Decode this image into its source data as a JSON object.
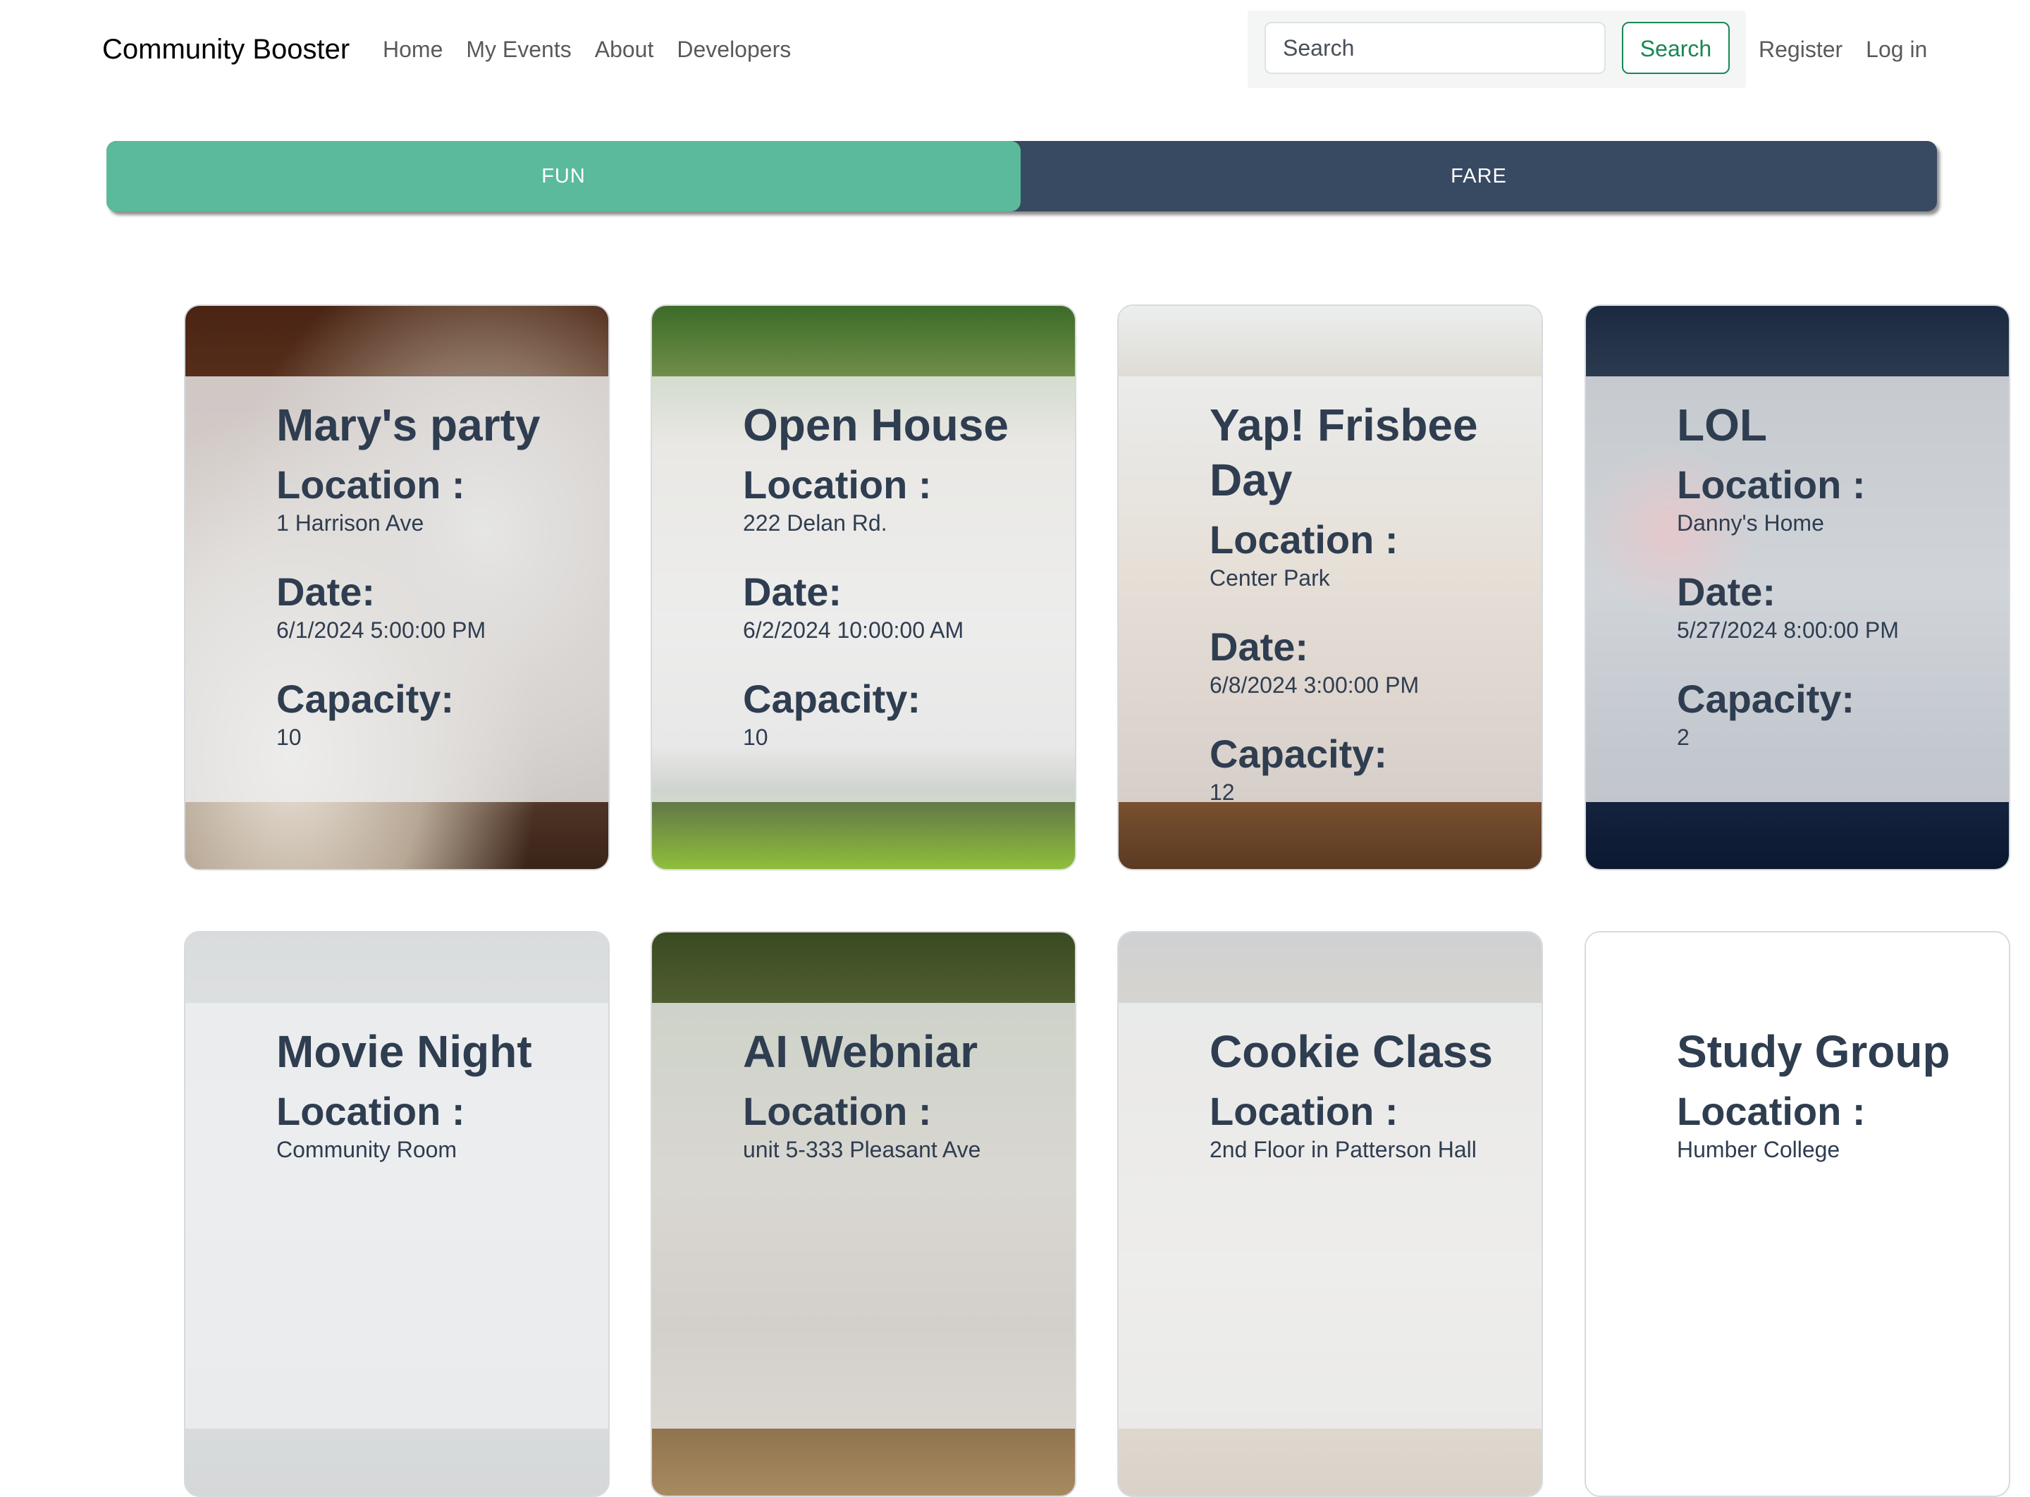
{
  "navbar": {
    "brand": "Community Booster",
    "links": [
      "Home",
      "My Events",
      "About",
      "Developers"
    ],
    "search_placeholder": "Search",
    "search_button": "Search",
    "auth": [
      "Register",
      "Log in"
    ]
  },
  "toggle": {
    "options": [
      "FUN",
      "FARE"
    ],
    "selected": "FUN",
    "colors": {
      "selected": "#5bba9b",
      "unselected": "#384a62"
    }
  },
  "labels": {
    "location": "Location :",
    "date": "Date:",
    "capacity": "Capacity:"
  },
  "events": [
    {
      "title": "Mary's party",
      "location": "1 Harrison Ave",
      "date": "6/1/2024 5:00:00 PM",
      "capacity": "10",
      "image": "party-photo"
    },
    {
      "title": "Open House",
      "location": "222 Delan Rd.",
      "date": "6/2/2024 10:00:00 AM",
      "capacity": "10",
      "image": "house-photo"
    },
    {
      "title": "Yap! Frisbee Day",
      "location": "Center Park",
      "date": "6/8/2024 3:00:00 PM",
      "capacity": "12",
      "image": "desert-walk-photo"
    },
    {
      "title": "LOL",
      "location": "Danny's Home",
      "date": "5/27/2024 8:00:00 PM",
      "capacity": "2",
      "image": "gaming-headset-photo"
    },
    {
      "title": "Movie Night",
      "location": "Community Room",
      "date": "",
      "capacity": "",
      "image": "room-photo"
    },
    {
      "title": "AI Webniar",
      "location": "unit 5-333 Pleasant Ave",
      "date": "",
      "capacity": "",
      "image": "tree-photo"
    },
    {
      "title": "Cookie Class",
      "location": "2nd Floor in Patterson Hall",
      "date": "",
      "capacity": "",
      "image": "baking-photo"
    },
    {
      "title": "Study Group",
      "location": "Humber College",
      "date": "",
      "capacity": "",
      "image": "none"
    }
  ]
}
